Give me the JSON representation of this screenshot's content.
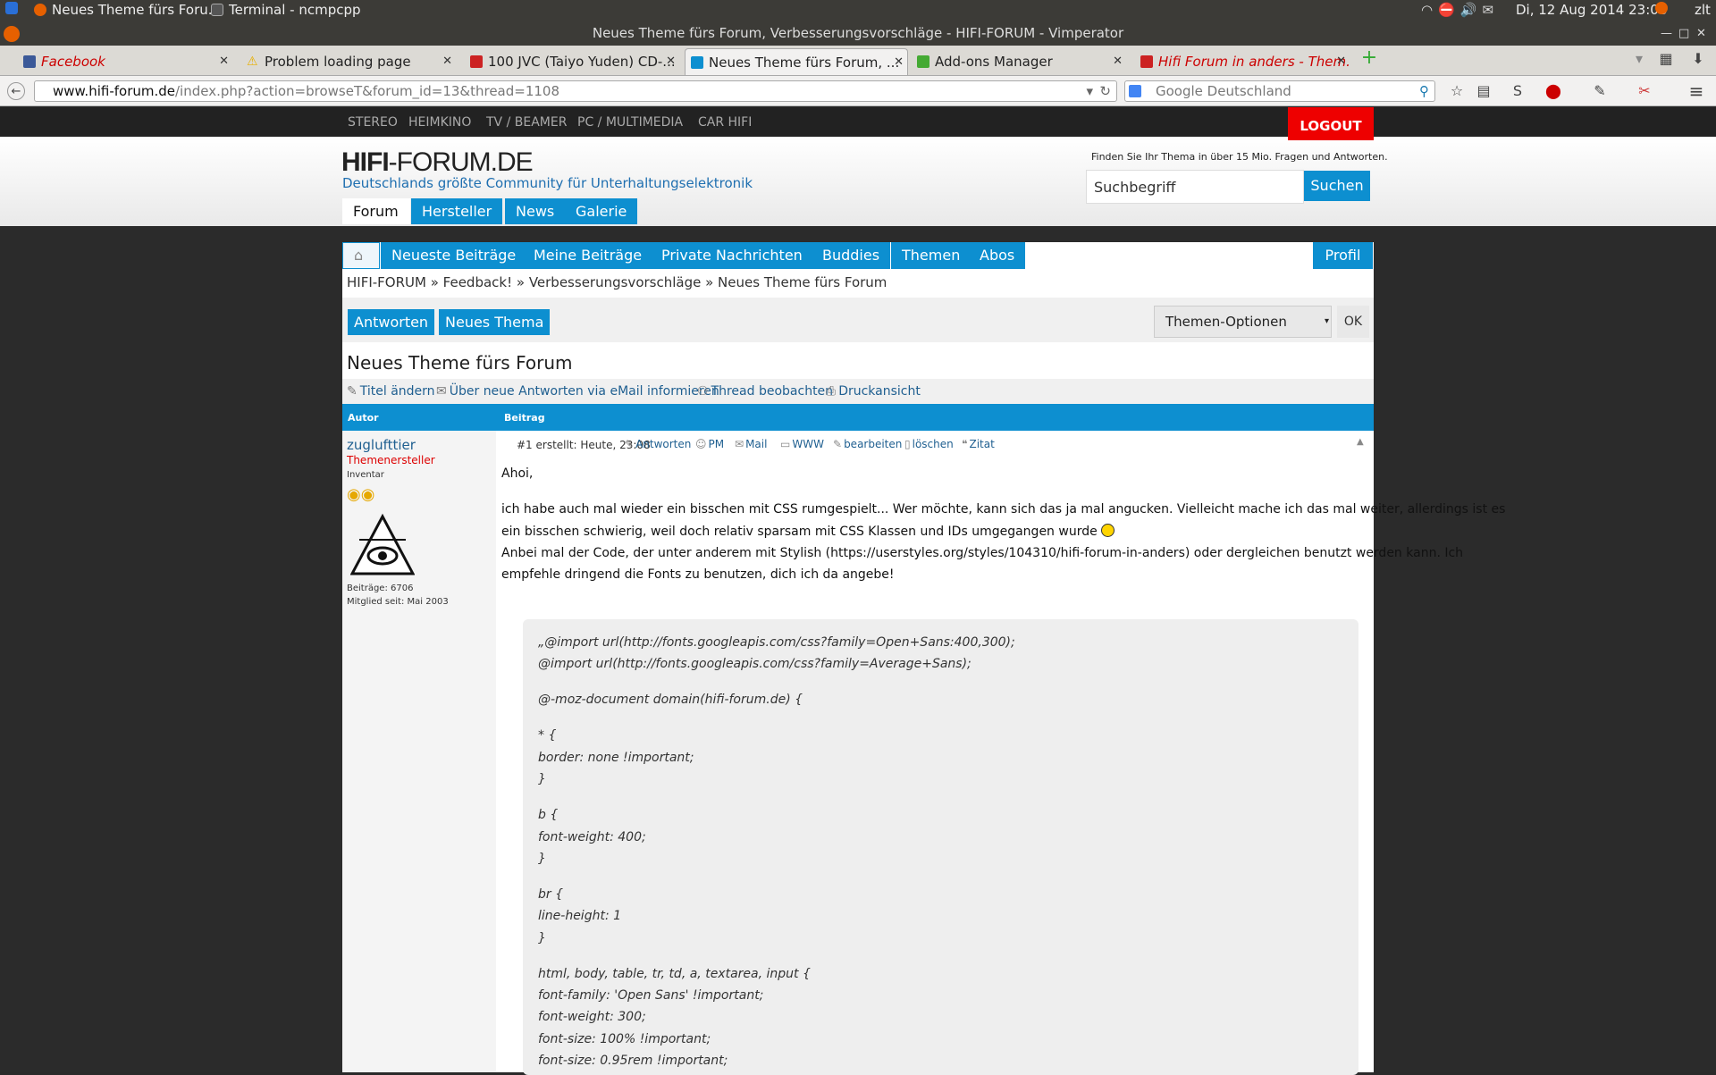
{
  "system": {
    "task1": "Neues Theme fürs Foru...",
    "task2": "Terminal - ncmpcpp",
    "datetime": "Di, 12 Aug 2014 23:08",
    "user": "zlt"
  },
  "window": {
    "title": "Neues Theme fürs Forum, Verbesserungsvorschläge - HIFI-FORUM - Vimperator"
  },
  "tabs": [
    {
      "label": "Facebook",
      "color": "#3b5998"
    },
    {
      "label": "Problem loading page",
      "color": "#e8b000"
    },
    {
      "label": "100 JVC (Taiyo Yuden) CD-...",
      "color": "#cc2222"
    },
    {
      "label": "Neues Theme fürs Forum, ...",
      "color": "#0d8fd0"
    },
    {
      "label": "Add-ons Manager",
      "color": "#44aa33"
    },
    {
      "label": "Hifi Forum in anders - Them...",
      "color": "#cc2222"
    }
  ],
  "nav": {
    "url_host": "www.hifi-forum.de",
    "url_path": "/index.php?action=browseT&forum_id=13&thread=1108",
    "search_placeholder": "Google Deutschland"
  },
  "site": {
    "categories": [
      "STEREO",
      "HEIMKINO",
      "TV / BEAMER",
      "PC / MULTIMEDIA",
      "CAR HIFI"
    ],
    "logout": "LOGOUT",
    "logo_bold": "HIFI",
    "logo_rest": "-FORUM.DE",
    "tagline": "Deutschlands größte Community für Unterhaltungselektronik",
    "main_tabs": [
      "Forum",
      "Hersteller",
      "News",
      "Galerie"
    ],
    "search_hint": "Finden Sie Ihr Thema in über 15 Mio. Fragen und Antworten.",
    "search_value": "Suchbegriff",
    "search_button": "Suchen",
    "nav_tabs": [
      "Neueste Beiträge",
      "Meine Beiträge",
      "Private Nachrichten",
      "Buddies",
      "Themen",
      "Abos"
    ],
    "profile": "Profil",
    "breadcrumb": "HIFI-FORUM » Feedback! » Verbesserungsvorschläge » Neues Theme fürs Forum",
    "btn_reply": "Antworten",
    "btn_new": "Neues Thema",
    "options": "Themen-Optionen",
    "ok": "OK",
    "thread_title": "Neues Theme fürs Forum",
    "tools": [
      "Titel ändern",
      "Über neue Antworten via eMail informieren",
      "Thread beobachten",
      "Druckansicht"
    ],
    "col_author": "Autor",
    "col_post": "Beitrag"
  },
  "post": {
    "author": "zuglufttier",
    "role": "Themenersteller",
    "rank": "Inventar",
    "posts": "Beiträge: 6706",
    "member_since": "Mitglied seit: Mai 2003",
    "meta": "#1 erstellt: Heute, 23:08",
    "actions": [
      "Antworten",
      "PM",
      "Mail",
      "WWW",
      "bearbeiten",
      "löschen",
      "Zitat"
    ],
    "greeting": "Ahoi,",
    "line1": "ich habe auch mal wieder ein bisschen mit CSS rumgespielt... Wer möchte, kann sich das ja mal angucken. Vielleicht mache ich das mal weiter, allerdings ist es",
    "line2": "ein bisschen schwierig, weil doch relativ sparsam mit CSS Klassen und IDs umgegangen wurde",
    "line3": "Anbei mal der Code, der unter anderem mit Stylish (https://userstyles.org/styles/104310/hifi-forum-in-anders) oder dergleichen benutzt werden kann. Ich",
    "line4": "empfehle dringend die Fonts zu benutzen, dich ich da angebe!",
    "code": [
      "„@import url(http://fonts.googleapis.com/css?family=Open+Sans:400,300);",
      "@import url(http://fonts.googleapis.com/css?family=Average+Sans);",
      "@-moz-document domain(hifi-forum.de) {",
      "* {",
      "border: none !important;",
      "}",
      "b {",
      "font-weight: 400;",
      "}",
      "br {",
      "line-height: 1",
      "}",
      "html, body, table, tr, td, a, textarea, input {",
      "font-family: 'Open Sans' !important;",
      "font-weight: 300;",
      "font-size: 100% !important;",
      "font-size: 0.95rem !important;"
    ]
  }
}
